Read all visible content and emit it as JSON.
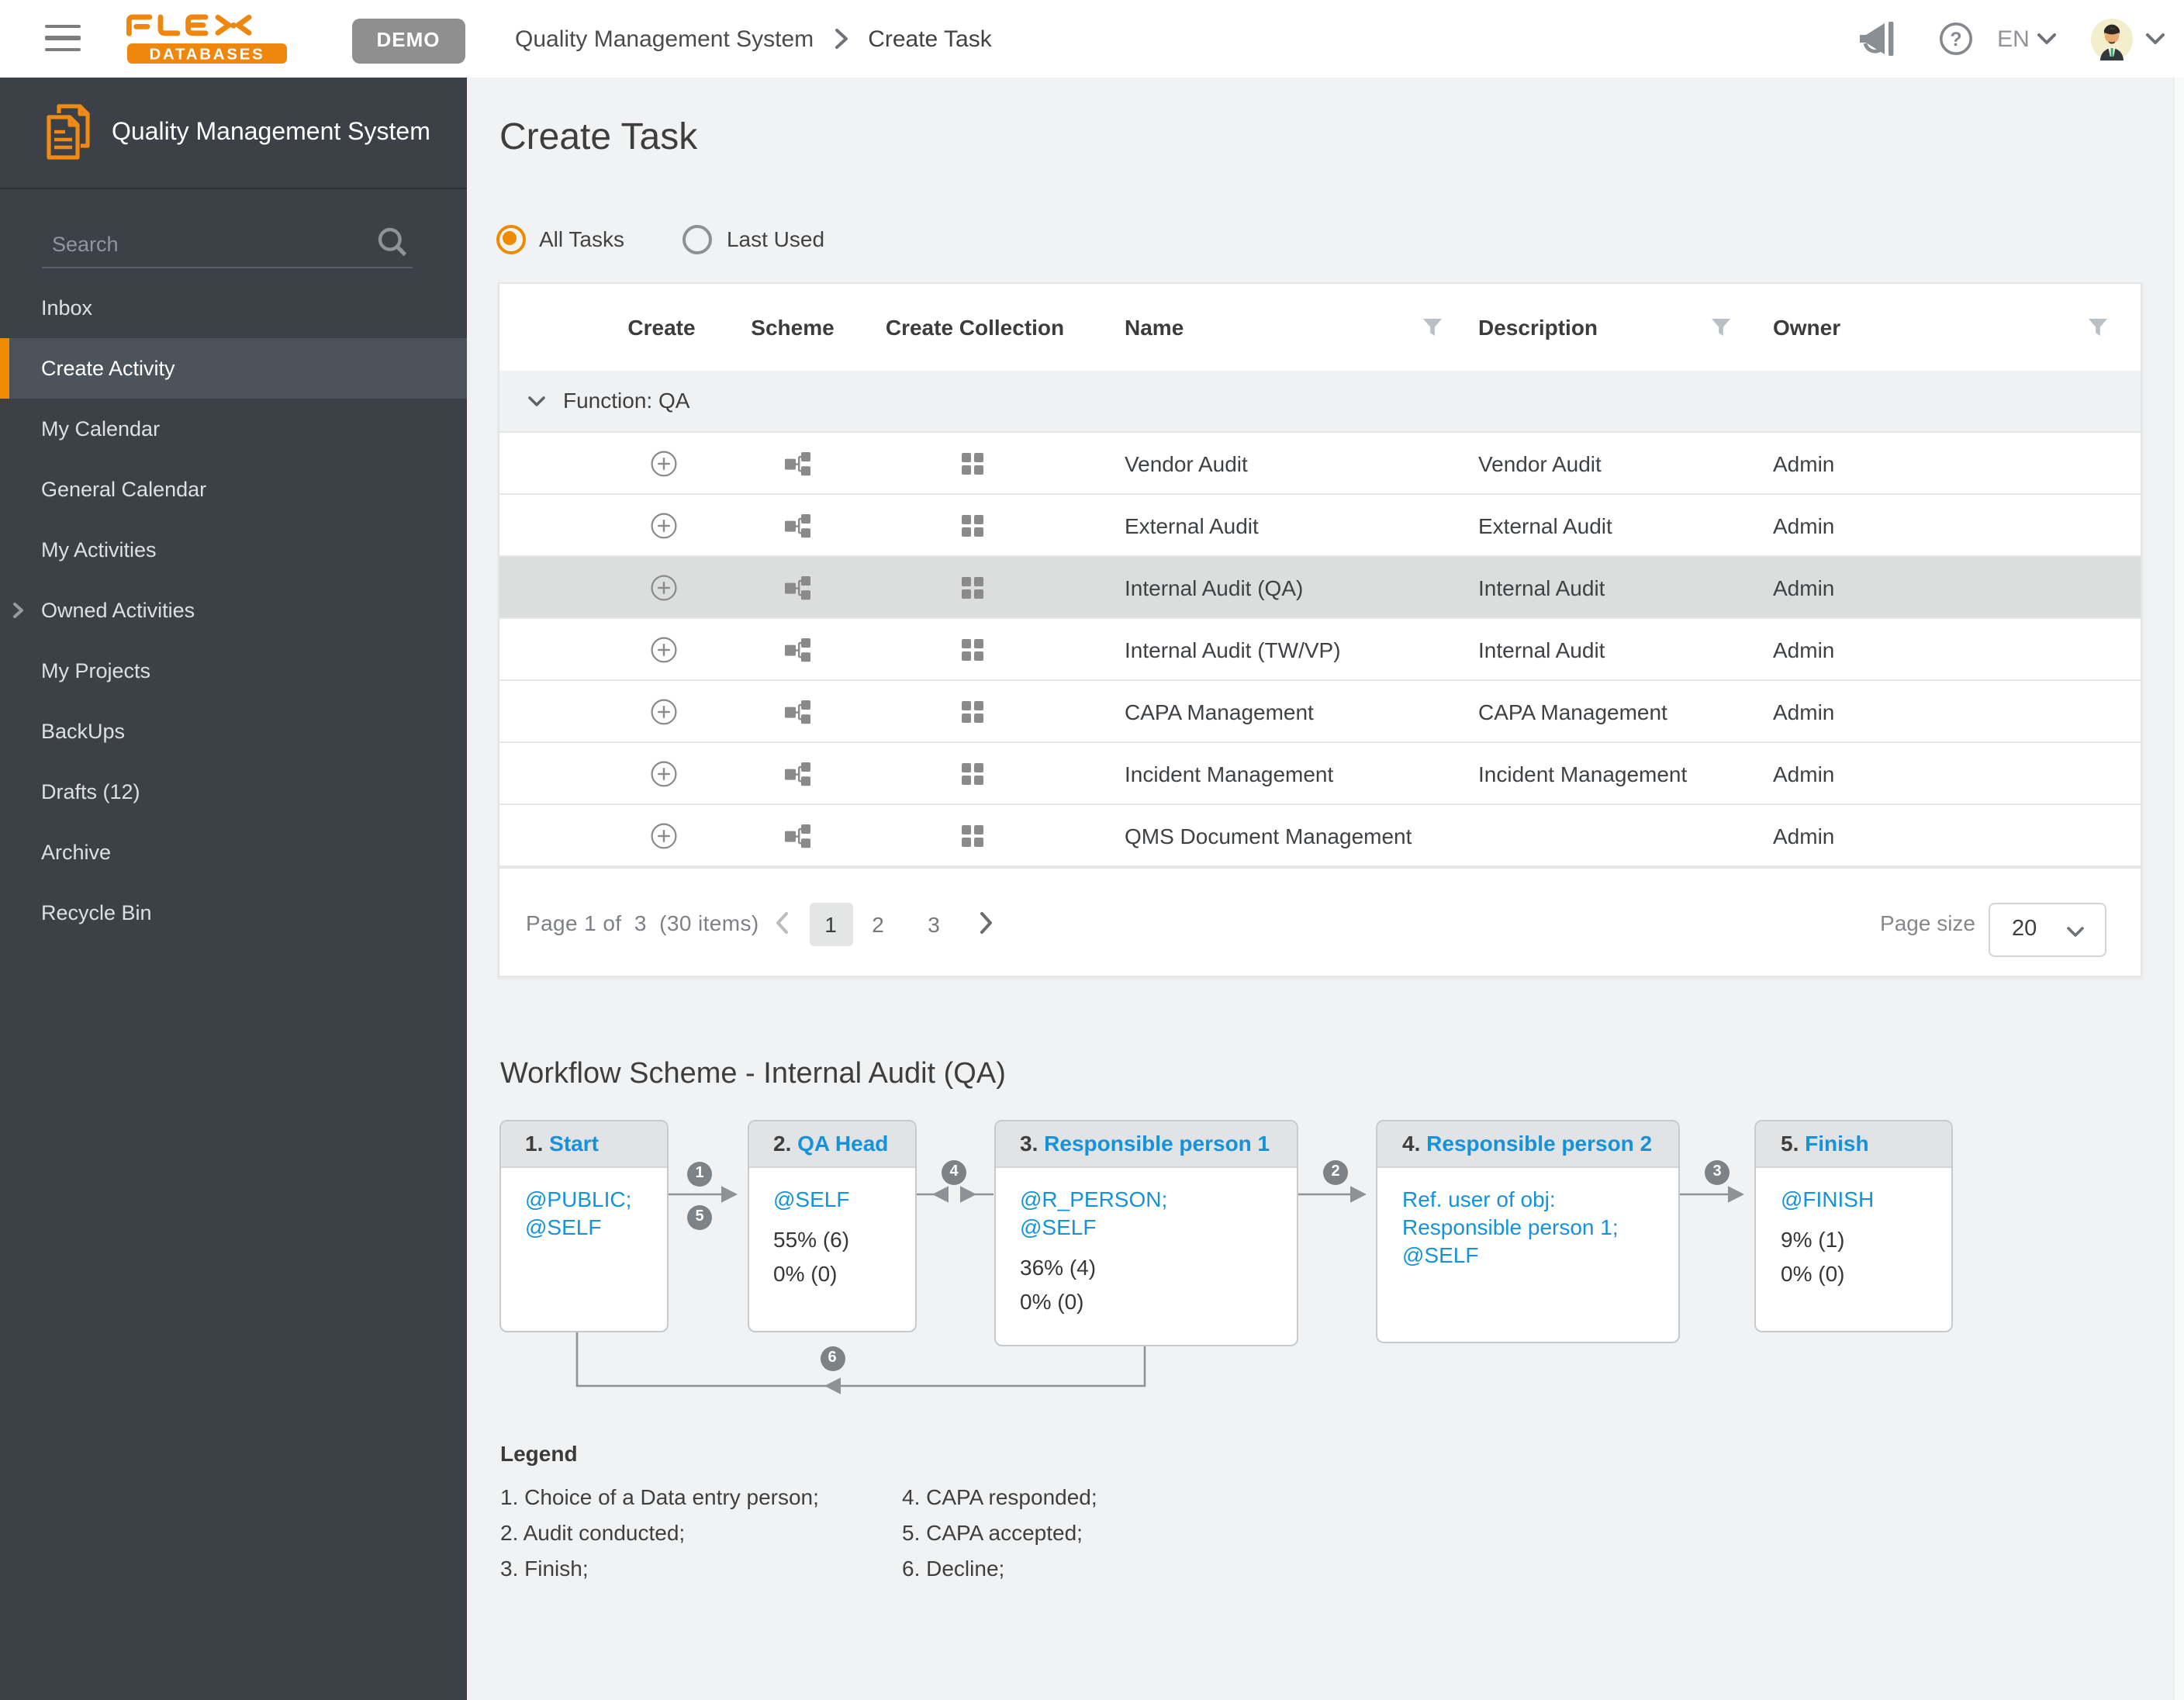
{
  "topbar": {
    "demo_label": "DEMO",
    "breadcrumb": {
      "module": "Quality Management System",
      "page": "Create Task"
    },
    "language": "EN",
    "logo": {
      "line1": "FLEX",
      "line2": "DATABASES"
    }
  },
  "sidebar": {
    "title": "Quality Management System",
    "search_placeholder": "Search",
    "items": [
      {
        "label": "Inbox"
      },
      {
        "label": "Create Activity",
        "active": true
      },
      {
        "label": "My Calendar"
      },
      {
        "label": "General Calendar"
      },
      {
        "label": "My Activities"
      },
      {
        "label": "Owned Activities",
        "expandable": true
      },
      {
        "label": "My Projects"
      },
      {
        "label": "BackUps"
      },
      {
        "label": "Drafts (12)"
      },
      {
        "label": "Archive"
      },
      {
        "label": "Recycle Bin"
      }
    ]
  },
  "page": {
    "title": "Create Task"
  },
  "filters": {
    "all_tasks": "All Tasks",
    "last_used": "Last Used",
    "selected": "All Tasks"
  },
  "table": {
    "columns": {
      "create": "Create",
      "scheme": "Scheme",
      "collection": "Create Collection",
      "name": "Name",
      "description": "Description",
      "owner": "Owner"
    },
    "group_label": "Function: QA",
    "rows": [
      {
        "name": "Vendor Audit",
        "description": "Vendor Audit",
        "owner": "Admin",
        "selected": false
      },
      {
        "name": "External Audit",
        "description": "External Audit",
        "owner": "Admin",
        "selected": false
      },
      {
        "name": "Internal Audit (QA)",
        "description": "Internal Audit",
        "owner": "Admin",
        "selected": true
      },
      {
        "name": "Internal Audit (TW/VP)",
        "description": "Internal Audit",
        "owner": "Admin",
        "selected": false
      },
      {
        "name": "CAPA Management",
        "description": "CAPA Management",
        "owner": "Admin",
        "selected": false
      },
      {
        "name": "Incident Management",
        "description": "Incident Management",
        "owner": "Admin",
        "selected": false
      },
      {
        "name": "QMS Document Management",
        "description": "",
        "owner": "Admin",
        "selected": false
      }
    ]
  },
  "pagination": {
    "summary": "Page 1 of  3  (30 items)",
    "pages": {
      "p1": "1",
      "p2": "2",
      "p3": "3"
    },
    "current_page": "1",
    "page_size_label": "Page size",
    "page_size": "20"
  },
  "workflow": {
    "title": "Workflow Scheme - Internal Audit (QA)",
    "steps": [
      {
        "number": "1.",
        "name": "Start",
        "lines": {
          "l1": "@PUBLIC;",
          "l2": "@SELF"
        },
        "stats": {}
      },
      {
        "number": "2.",
        "name": "QA Head",
        "lines": {
          "l1": "@SELF"
        },
        "stats": {
          "s1": "55% (6)",
          "s2": "0% (0)"
        }
      },
      {
        "number": "3.",
        "name": "Responsible person 1",
        "lines": {
          "l1": "@R_PERSON;",
          "l2": "@SELF"
        },
        "stats": {
          "s1": "36% (4)",
          "s2": "0% (0)"
        }
      },
      {
        "number": "4.",
        "name": "Responsible person 2",
        "lines": {
          "l1": "Ref. user of obj:",
          "l2": "Responsible person 1;",
          "l3": "@SELF"
        },
        "stats": {}
      },
      {
        "number": "5.",
        "name": "Finish",
        "lines": {
          "l1": "@FINISH"
        },
        "stats": {
          "s1": "9% (1)",
          "s2": "0% (0)"
        }
      }
    ],
    "transitions": {
      "t1": "1",
      "t2": "2",
      "t3": "3",
      "t4": "4",
      "t5": "5",
      "t6": "6"
    }
  },
  "legend": {
    "title": "Legend",
    "left": {
      "i1": "1. Choice of a Data entry person;",
      "i2": "2. Audit conducted;",
      "i3": "3. Finish;"
    },
    "right": {
      "i1": "4. CAPA responded;",
      "i2": "5. CAPA accepted;",
      "i3": "6. Decline;"
    }
  },
  "colors": {
    "accent_orange": "#f28b00",
    "sidebar_bg": "#3c4147",
    "sidebar_active_bg": "#4c535a",
    "main_bg": "#f1f2f3",
    "link_blue": "#1493dc",
    "selected_row": "#dcdddd",
    "badge_gray": "#7d8286"
  }
}
